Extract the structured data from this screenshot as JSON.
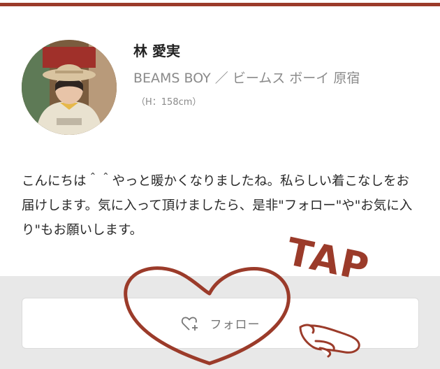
{
  "profile": {
    "name": "林 愛実",
    "shop": "BEAMS BOY ／ ビームス ボーイ 原宿",
    "height": "（H：158cm）",
    "bio": "こんにちは＾＾やっと暖かくなりましたね。私らしい着こなしをお届けします。気に入って頂けましたら、是非\"フォロー\"や\"お気に入り\"もお願いします。"
  },
  "follow": {
    "label": "フォロー",
    "icon": "heart-plus-icon"
  },
  "annotation": {
    "tap_text": "TAP"
  },
  "colors": {
    "accent": "#9b3b2a",
    "follow_area_bg": "#e8e8e8",
    "muted_text": "#8a8a8a"
  }
}
